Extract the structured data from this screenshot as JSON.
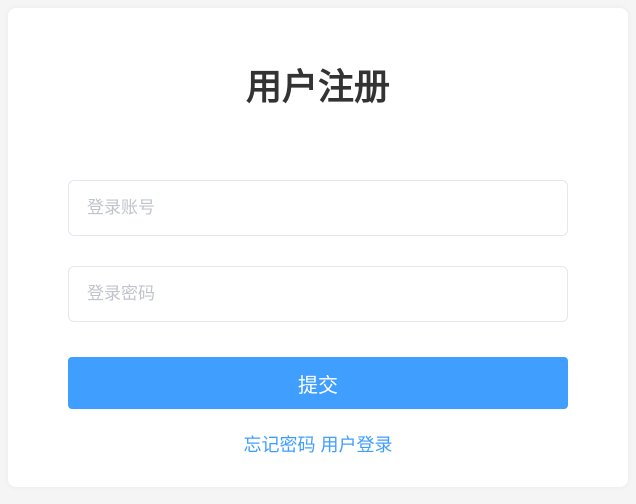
{
  "title": "用户注册",
  "form": {
    "account": {
      "value": "",
      "placeholder": "登录账号"
    },
    "password": {
      "value": "",
      "placeholder": "登录密码"
    },
    "submit_label": "提交"
  },
  "links": {
    "forgot_password": "忘记密码",
    "login": "用户登录"
  }
}
